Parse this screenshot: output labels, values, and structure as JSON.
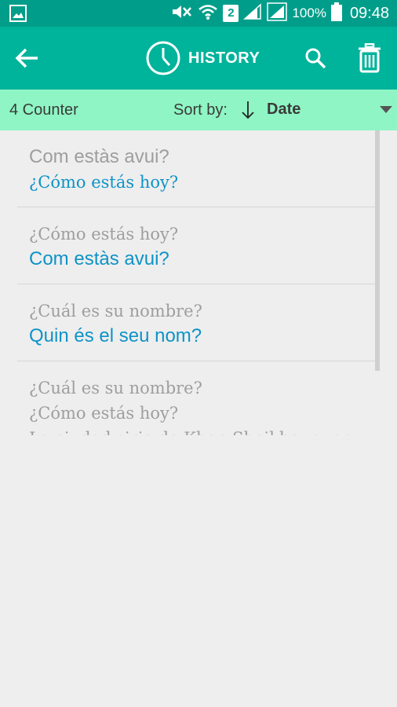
{
  "status_bar": {
    "sim_slot": "2",
    "battery": "100%",
    "time": "09:48",
    "icons": [
      "image-notification-icon",
      "mute-icon",
      "wifi-icon",
      "signal-icon",
      "signal-icon",
      "battery-icon"
    ]
  },
  "app_bar": {
    "title": "HISTORY",
    "icons": [
      "back-arrow-icon",
      "clock-icon",
      "search-icon",
      "trash-icon"
    ],
    "color": "#00b39b"
  },
  "sort_bar": {
    "counter": "4 Counter",
    "sort_label": "Sort by:",
    "sort_value": "Date",
    "color": "#8ff5c4"
  },
  "history": [
    {
      "source": "Com estàs avui?",
      "target": "¿Cómo estás hoy?"
    },
    {
      "source": "¿Cómo estás hoy?",
      "target": "Com estàs avui?"
    },
    {
      "source": "¿Cuál es su nombre?",
      "target": "Quin és el seu nom?"
    },
    {
      "source": "¿Cuál es su nombre?",
      "target": "¿Cómo estás hoy?",
      "extra": "La ciudad siria de Khan Sheikhoun, en"
    }
  ]
}
